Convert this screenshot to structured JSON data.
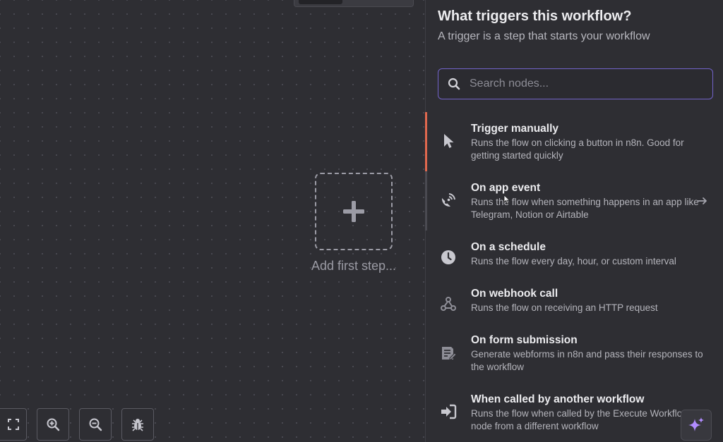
{
  "canvas": {
    "add_step_label": "Add first step..."
  },
  "panel": {
    "title": "What triggers this workflow?",
    "subtitle": "A trigger is a step that starts your workflow",
    "search": {
      "placeholder": "Search nodes...",
      "value": ""
    },
    "nodes": [
      {
        "icon": "pointer-icon",
        "name": "Trigger manually",
        "description": "Runs the flow on clicking a button in n8n. Good for getting started quickly",
        "has_arrow": false
      },
      {
        "icon": "satellite-dish-icon",
        "name": "On app event",
        "description": "Runs the flow when something happens in an app like Telegram, Notion or Airtable",
        "has_arrow": true
      },
      {
        "icon": "clock-icon",
        "name": "On a schedule",
        "description": "Runs the flow every day, hour, or custom interval",
        "has_arrow": false
      },
      {
        "icon": "webhook-icon",
        "name": "On webhook call",
        "description": "Runs the flow on receiving an HTTP request",
        "has_arrow": false
      },
      {
        "icon": "form-icon",
        "name": "On form submission",
        "description": "Generate webforms in n8n and pass their responses to the workflow",
        "has_arrow": false
      },
      {
        "icon": "sign-in-icon",
        "name": "When called by another workflow",
        "description": "Runs the flow when called by the Execute Workflow node from a different workflow",
        "has_arrow": false
      }
    ]
  },
  "zoom_controls": [
    "fit-view-icon",
    "zoom-in-icon",
    "zoom-out-icon",
    "bug-icon"
  ],
  "colors": {
    "accent": "#7263c9",
    "active_indicator": "#e0684e",
    "background": "#2e2e33",
    "ai_sparkle": "#b18cff"
  }
}
